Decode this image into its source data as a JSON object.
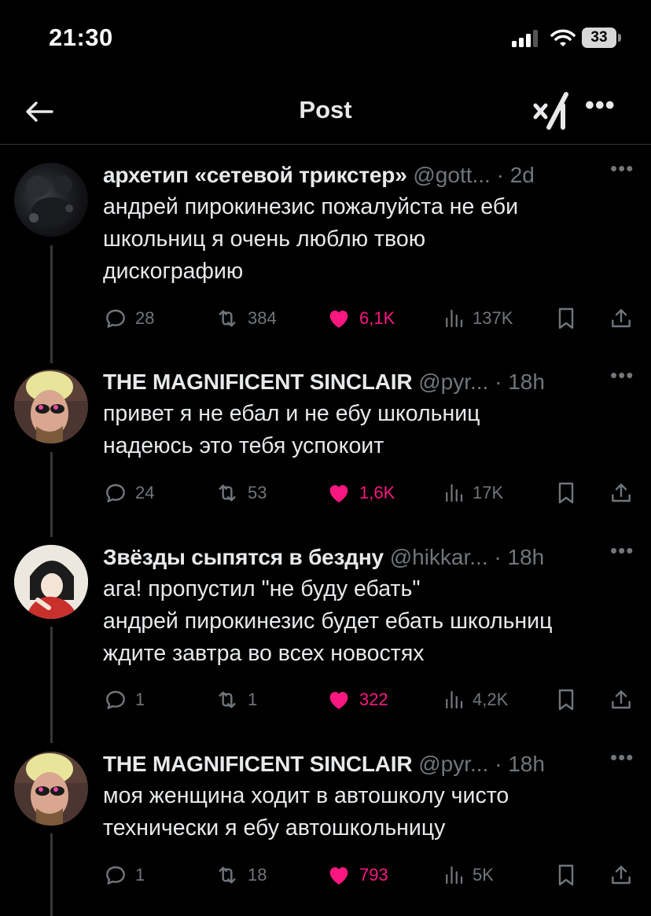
{
  "status_bar": {
    "time": "21:30",
    "battery": "33"
  },
  "nav": {
    "title": "Post",
    "back_icon": "arrow-left-icon",
    "grok_icon": "grok-icon",
    "more_icon": "more-icon"
  },
  "colors": {
    "background": "#000000",
    "text": "#e7e9ea",
    "muted": "#71767b",
    "like": "#f91880",
    "separator": "#2f3336"
  },
  "posts": [
    {
      "name": "архетип «сетевой трикстер»",
      "handle": "@gott...",
      "time": "· 2d",
      "text": [
        "андрей пирокинезис пожалуйста не еби",
        "школьниц я очень люблю твою",
        "дискографию"
      ],
      "replies": "28",
      "reposts": "384",
      "likes": "6,1K",
      "views": "137K"
    },
    {
      "name": "THE MAGNIFICENT SINCLAIR",
      "handle": "@pyr...",
      "time": "· 18h",
      "text": [
        "привет я не ебал и не ебу школьниц",
        "надеюсь это тебя успокоит"
      ],
      "replies": "24",
      "reposts": "53",
      "likes": "1,6K",
      "views": "17K"
    },
    {
      "name": "Звёзды сыпятся в бездну",
      "handle": "@hikkar...",
      "time": "· 18h",
      "text": [
        "ага! пропустил \"не буду ебать\"",
        "андрей пирокинезис будет ебать школьниц",
        "ждите завтра во всех новостях"
      ],
      "replies": "1",
      "reposts": "1",
      "likes": "322",
      "views": "4,2K"
    },
    {
      "name": "THE MAGNIFICENT SINCLAIR",
      "handle": "@pyr...",
      "time": "· 18h",
      "text": [
        "моя женщина ходит в автошколу чисто",
        "технически я ебу автошкольницу"
      ],
      "replies": "1",
      "reposts": "18",
      "likes": "793",
      "views": "5K"
    }
  ]
}
